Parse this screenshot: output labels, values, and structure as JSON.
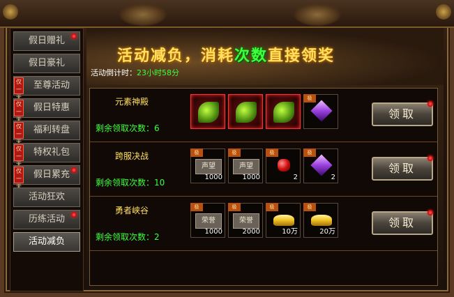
{
  "banner": {
    "title_part1": "活动减负，消耗",
    "title_part2": "次数",
    "title_part3": "直接领奖"
  },
  "countdown": {
    "label": "活动倒计时：",
    "value": "23小时58分"
  },
  "sidebar": {
    "items": [
      {
        "label": "假日赠礼",
        "tag": "",
        "dot": true
      },
      {
        "label": "假日豪礼",
        "tag": "",
        "dot": false
      },
      {
        "label": "至尊活动",
        "tag": "仅一天",
        "dot": false
      },
      {
        "label": "假日特惠",
        "tag": "仅一天",
        "dot": false
      },
      {
        "label": "福利转盘",
        "tag": "仅一天",
        "dot": false
      },
      {
        "label": "特权礼包",
        "tag": "仅一天",
        "dot": false
      },
      {
        "label": "假日累充",
        "tag": "仅一天",
        "dot": true
      },
      {
        "label": "活动狂欢",
        "tag": "",
        "dot": false
      },
      {
        "label": "历练活动",
        "tag": "",
        "dot": true
      },
      {
        "label": "活动减负",
        "tag": "",
        "dot": false,
        "active": true
      }
    ]
  },
  "rows": [
    {
      "name": "元素神殿",
      "count_label": "剩余领取次数：6",
      "button": "领取",
      "items": [
        {
          "kind": "leaf",
          "qty": "",
          "tag": ""
        },
        {
          "kind": "leaf",
          "qty": "",
          "tag": ""
        },
        {
          "kind": "leaf",
          "qty": "",
          "tag": ""
        },
        {
          "kind": "crystal",
          "qty": "",
          "tag": "极"
        }
      ]
    },
    {
      "name": "跨服决战",
      "count_label": "剩余领取次数：10",
      "button": "领取",
      "items": [
        {
          "kind": "ticket",
          "text": "声望",
          "qty": "1000",
          "tag": "极"
        },
        {
          "kind": "ticket",
          "text": "声望",
          "qty": "1000",
          "tag": "极"
        },
        {
          "kind": "ruby",
          "qty": "2",
          "tag": "极"
        },
        {
          "kind": "crystal",
          "qty": "2",
          "tag": "极"
        }
      ]
    },
    {
      "name": "勇者峡谷",
      "count_label": "剩余领取次数：2",
      "button": "领取",
      "items": [
        {
          "kind": "ticket",
          "text": "荣誉",
          "qty": "1000",
          "tag": "极"
        },
        {
          "kind": "ticket",
          "text": "荣誉",
          "qty": "2000",
          "tag": "极"
        },
        {
          "kind": "ingot",
          "qty": "10万",
          "tag": "极"
        },
        {
          "kind": "ingot",
          "qty": "20万",
          "tag": "极"
        }
      ]
    }
  ]
}
